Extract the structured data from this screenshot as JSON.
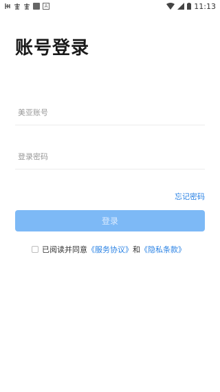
{
  "status_bar": {
    "left_icons": [
      "notification-icon-1",
      "notification-icon-2",
      "notification-icon-3",
      "square-icon",
      "a-icon"
    ],
    "a_icon_text": "A",
    "time": "11:13"
  },
  "login": {
    "title": "账号登录",
    "account_placeholder": "美亚账号",
    "password_placeholder": "登录密码",
    "forgot_password": "忘记密码",
    "submit_label": "登录"
  },
  "agreement": {
    "prefix": "已阅读并同意",
    "service_link": "《服务协议》",
    "connector": "和",
    "privacy_link": "《隐私条款》"
  },
  "colors": {
    "accent": "#2a82e4",
    "button_bg": "#7db9f6",
    "button_text": "#dcecff",
    "title": "#1a1a1a"
  }
}
